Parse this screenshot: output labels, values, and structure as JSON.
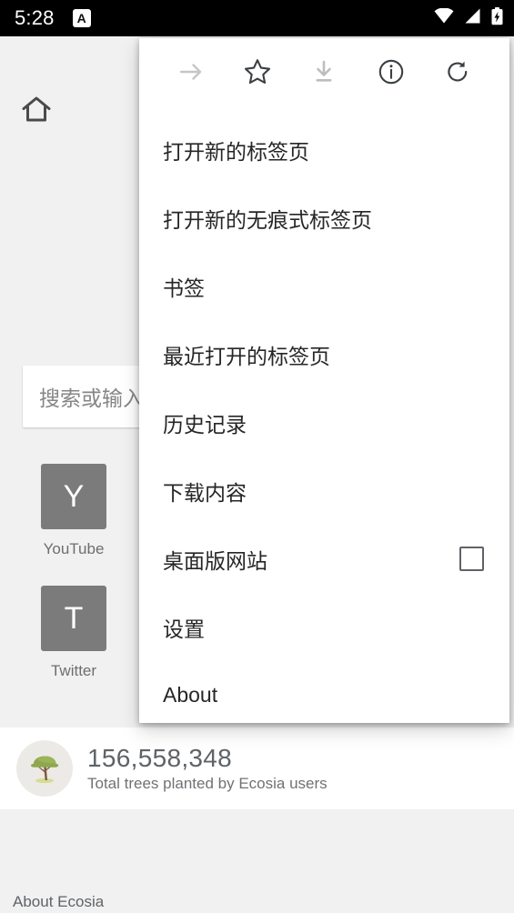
{
  "status_bar": {
    "time": "5:28",
    "app_badge": "A",
    "icons": [
      "wifi-icon",
      "cellular-signal-icon",
      "battery-charging-icon"
    ]
  },
  "page": {
    "home_icon": "home-icon",
    "omnibox": {
      "placeholder": "搜索或输入网址"
    },
    "tiles": [
      {
        "initial": "Y",
        "label": "YouTube"
      },
      {
        "initial": "T",
        "label": "Twitter"
      }
    ],
    "ecosia_banner": {
      "icon": "tree-icon",
      "count": "156,558,348",
      "caption": "Total trees planted by Ecosia users"
    },
    "footer": {
      "about_label": "About Ecosia"
    }
  },
  "app_menu": {
    "icon_row": [
      {
        "name": "forward-icon",
        "enabled": false
      },
      {
        "name": "bookmark-star-icon",
        "enabled": true
      },
      {
        "name": "download-icon",
        "enabled": false
      },
      {
        "name": "page-info-icon",
        "enabled": true
      },
      {
        "name": "reload-icon",
        "enabled": true
      }
    ],
    "items": [
      {
        "label": "打开新的标签页",
        "type": "item"
      },
      {
        "label": "打开新的无痕式标签页",
        "type": "item"
      },
      {
        "label": "书签",
        "type": "item"
      },
      {
        "label": "最近打开的标签页",
        "type": "item"
      },
      {
        "label": "历史记录",
        "type": "item"
      },
      {
        "label": "下载内容",
        "type": "item"
      },
      {
        "label": "桌面版网站",
        "type": "checkbox",
        "checked": false
      },
      {
        "label": "设置",
        "type": "item"
      },
      {
        "label": "About",
        "type": "item"
      }
    ]
  },
  "colors": {
    "status_bar_bg": "#000000",
    "page_bg": "#f1f1f1",
    "menu_bg": "#ffffff",
    "menu_text": "#262626",
    "tile_bg": "#7b7b7b",
    "muted_text": "#5f6368",
    "icon_enabled": "#4a4a4a",
    "icon_disabled": "#c6c6c6",
    "tree_canopy": "#8ea84e",
    "tree_trunk": "#7d5a3c",
    "tree_ground": "#d7dc93"
  }
}
